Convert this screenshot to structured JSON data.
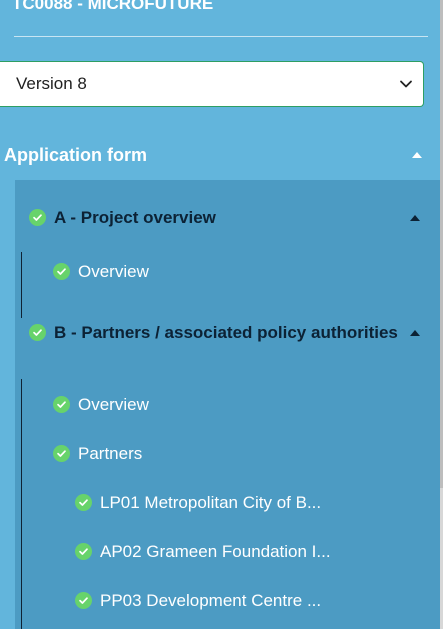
{
  "project": {
    "title": "TC0088 - MICROFUTURE"
  },
  "version_select": {
    "selected": "Version 8"
  },
  "application_form": {
    "title": "Application form",
    "sections": [
      {
        "title": "A - Project overview",
        "items": [
          {
            "label": "Overview"
          }
        ]
      },
      {
        "title": "B - Partners / associated policy authorities",
        "items": [
          {
            "label": "Overview"
          },
          {
            "label": "Partners"
          },
          {
            "label": "LP01 Metropolitan City of B..."
          },
          {
            "label": "AP02 Grameen Foundation I..."
          },
          {
            "label": "PP03 Development Centre ..."
          }
        ]
      }
    ]
  },
  "colors": {
    "panel": "#62b5dc",
    "section_bg": "#4c9bc3",
    "check": "#67d36b",
    "select_border": "#2e9e63"
  }
}
